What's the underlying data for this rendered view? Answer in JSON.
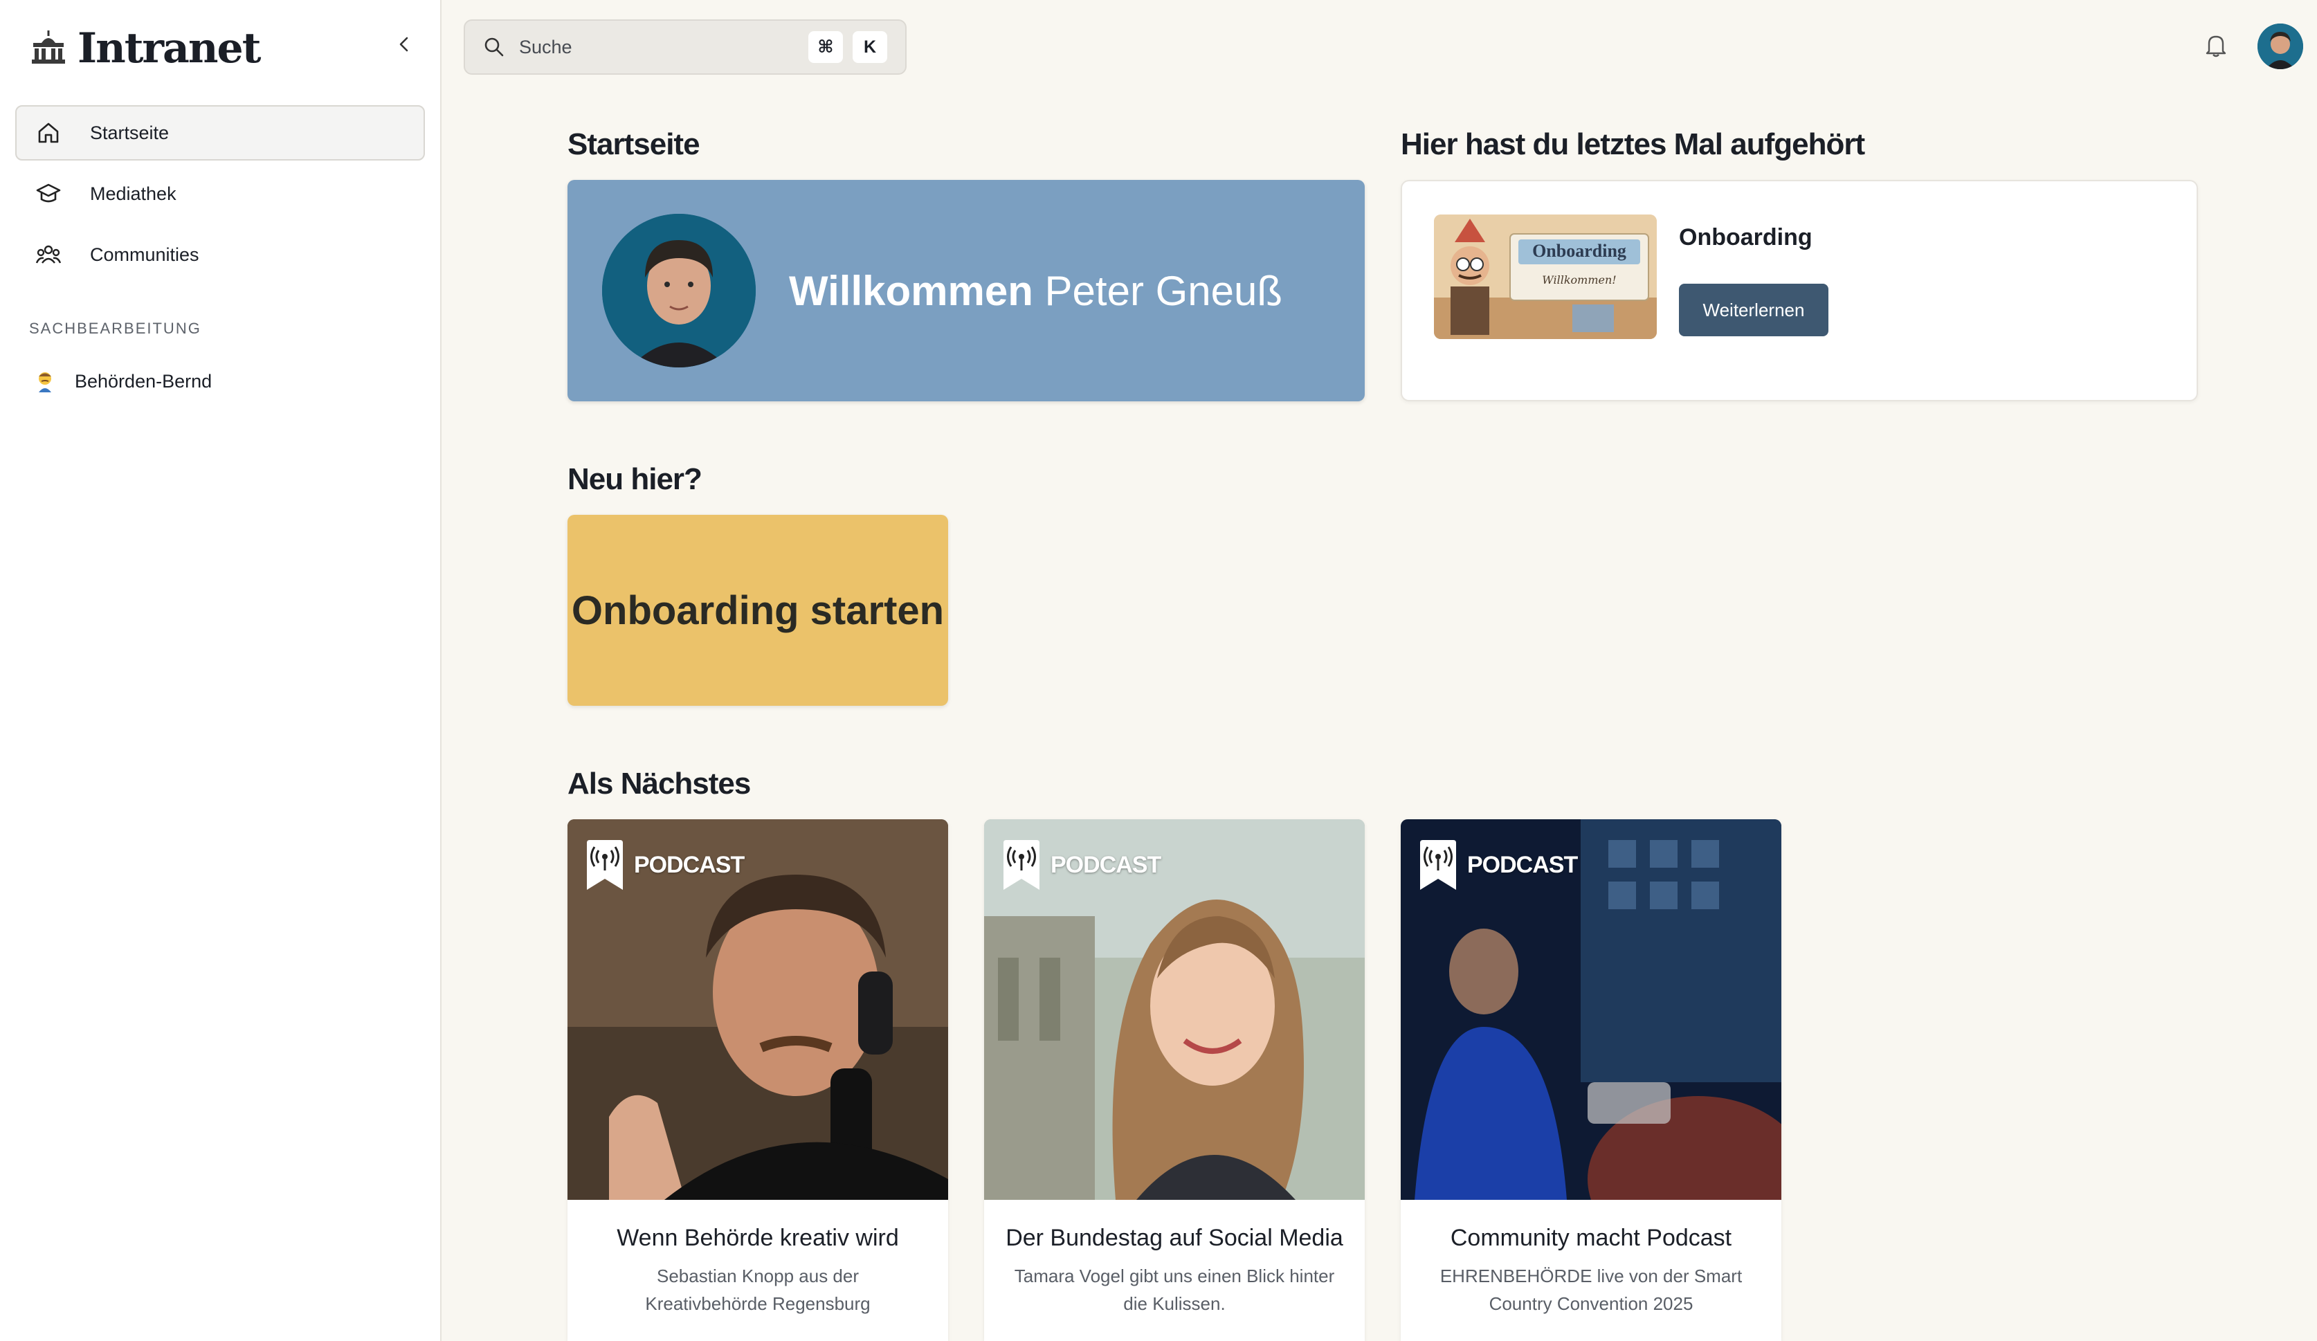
{
  "app": {
    "brand": "Intranet"
  },
  "sidebar": {
    "items": [
      {
        "label": "Startseite",
        "icon": "home-icon",
        "active": true
      },
      {
        "label": "Mediathek",
        "icon": "graduation-cap-icon",
        "active": false
      },
      {
        "label": "Communities",
        "icon": "users-icon",
        "active": false
      }
    ],
    "section_title": "SACHBEARBEITUNG",
    "communities": [
      {
        "label": "Behörden-Bernd",
        "icon": "person-emoji-icon"
      }
    ]
  },
  "search": {
    "placeholder": "Suche",
    "shortcut_mod": "⌘",
    "shortcut_key": "K"
  },
  "main": {
    "home_heading": "Startseite",
    "welcome": {
      "greeting": "Willkommen",
      "name": "Peter Gneuß"
    },
    "resume_heading": "Hier hast du letztes Mal aufgehört",
    "resume": {
      "title": "Onboarding",
      "button": "Weiterlernen",
      "thumb_title": "Onboarding",
      "thumb_caption": "Willkommen!"
    },
    "new_heading": "Neu hier?",
    "onboarding_button": "Onboarding starten",
    "next_heading": "Als Nächstes",
    "cards": [
      {
        "badge": "PODCAST",
        "title": "Wenn Behörde kreativ wird",
        "subtitle": "Sebastian Knopp aus der Kreativbehörde Regensburg"
      },
      {
        "badge": "PODCAST",
        "title": "Der Bundestag auf Social Media",
        "subtitle": "Tamara Vogel gibt uns einen Blick hinter die Kulissen."
      },
      {
        "badge": "PODCAST",
        "title": "Community macht Podcast",
        "subtitle": "EHRENBEHÖRDE live von der Smart Country Convention 2025"
      }
    ]
  },
  "colors": {
    "background": "#f9f7f1",
    "welcome_card": "#7b9fc1",
    "onboarding_card": "#ebc26a",
    "primary_button": "#3e5871"
  }
}
